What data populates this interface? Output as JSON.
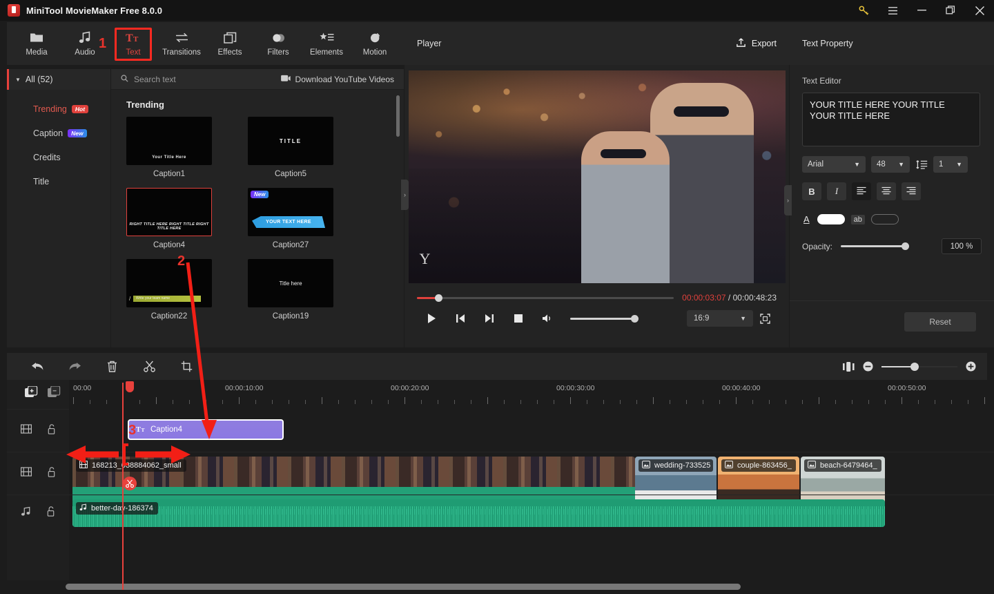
{
  "window": {
    "app_title": "MiniTool MovieMaker Free 8.0.0",
    "controls": {
      "key": "🔑",
      "menu": "☰",
      "minimize": "—",
      "maximize": "❐",
      "close": "✕"
    }
  },
  "navbar": {
    "items": [
      {
        "label": "Media",
        "icon": "folder-icon"
      },
      {
        "label": "Audio",
        "icon": "music-note-icon"
      },
      {
        "label": "Text",
        "icon": "text-icon"
      },
      {
        "label": "Transitions",
        "icon": "transitions-icon"
      },
      {
        "label": "Effects",
        "icon": "effects-icon"
      },
      {
        "label": "Filters",
        "icon": "filters-icon"
      },
      {
        "label": "Elements",
        "icon": "elements-icon"
      },
      {
        "label": "Motion",
        "icon": "motion-icon"
      }
    ],
    "active_index": 2
  },
  "sidebar": {
    "all_label": "All (52)",
    "items": [
      {
        "label": "Trending",
        "badge": "Hot",
        "badge_type": "hot",
        "selected": true
      },
      {
        "label": "Caption",
        "badge": "New",
        "badge_type": "new",
        "selected": false
      },
      {
        "label": "Credits",
        "badge": "",
        "badge_type": "",
        "selected": false
      },
      {
        "label": "Title",
        "badge": "",
        "badge_type": "",
        "selected": false
      }
    ]
  },
  "gallery": {
    "search_placeholder": "Search text",
    "download_label": "Download YouTube Videos",
    "section_title": "Trending",
    "templates": [
      {
        "name": "Caption1",
        "preview_text": "Your  Title Here",
        "badge": "",
        "selected": false
      },
      {
        "name": "Caption5",
        "preview_text": "TITLE",
        "badge": "",
        "selected": false
      },
      {
        "name": "Caption4",
        "preview_text": "RIGHT TITLE HERE RIGHT TITLE RIGHT TITLE HERE",
        "badge": "",
        "selected": true
      },
      {
        "name": "Caption27",
        "preview_text": "YOUR TEXT HERE",
        "badge": "New",
        "selected": false
      },
      {
        "name": "Caption22",
        "preview_text": "Write your team name",
        "badge": "",
        "selected": false
      },
      {
        "name": "Caption19",
        "preview_text": "Title here",
        "badge": "",
        "selected": false
      }
    ]
  },
  "player": {
    "label": "Player",
    "export_label": "Export",
    "stage_overlay_text": "Y",
    "current_time": "00:00:03:07",
    "separator": "/",
    "total_time": "00:00:48:23",
    "aspect_ratio": "16:9",
    "controls": {
      "play": "play-icon",
      "prev_frame": "previous-frame-icon",
      "next_frame": "next-frame-icon",
      "stop": "stop-icon",
      "volume": "volume-icon",
      "fullscreen": "fullscreen-icon"
    }
  },
  "properties": {
    "panel_title": "Text Property",
    "section_label": "Text Editor",
    "text_value": "YOUR TITLE HERE YOUR TITLE YOUR TITLE HERE",
    "font_family": "Arial",
    "font_size": "48",
    "line_spacing": "1",
    "bold_label": "B",
    "italic_label": "I",
    "align_left": "align-left-icon",
    "align_center": "align-center-icon",
    "align_right": "align-right-icon",
    "text_color_icon": "A",
    "bg_color_icon": "ab",
    "text_color": "#ffffff",
    "bg_color": "transparent",
    "opacity_label": "Opacity:",
    "opacity_value": "100 %",
    "reset_label": "Reset"
  },
  "timeline": {
    "toolbar": [
      {
        "name": "undo-button",
        "icon": "undo-icon"
      },
      {
        "name": "redo-button",
        "icon": "redo-icon"
      },
      {
        "name": "delete-button",
        "icon": "trash-icon"
      },
      {
        "name": "split-button",
        "icon": "scissors-icon"
      },
      {
        "name": "crop-button",
        "icon": "crop-icon"
      }
    ],
    "ruler_labels": [
      "00:00",
      "00:00:10:00",
      "00:00:20:00",
      "00:00:30:00",
      "00:00:40:00",
      "00:00:50:00"
    ],
    "tracks": [
      {
        "type": "text",
        "clips": [
          {
            "label": "Caption4",
            "icon": "text-icon",
            "selected": true
          }
        ]
      },
      {
        "type": "video",
        "clips": [
          {
            "label": "168213_038884062_small",
            "icon": "video-icon"
          },
          {
            "label": "wedding-733525",
            "icon": "image-icon"
          },
          {
            "label": "couple-863456_",
            "icon": "image-icon"
          },
          {
            "label": "beach-6479464_",
            "icon": "image-icon"
          }
        ]
      },
      {
        "type": "audio",
        "clips": [
          {
            "label": "better-day-186374",
            "icon": "music-note-icon"
          }
        ]
      }
    ]
  },
  "annotations": [
    {
      "number": "1",
      "target": "text-tab"
    },
    {
      "number": "2",
      "target": "caption4-template"
    },
    {
      "number": "3",
      "target": "caption4-timeline-clip"
    }
  ]
}
